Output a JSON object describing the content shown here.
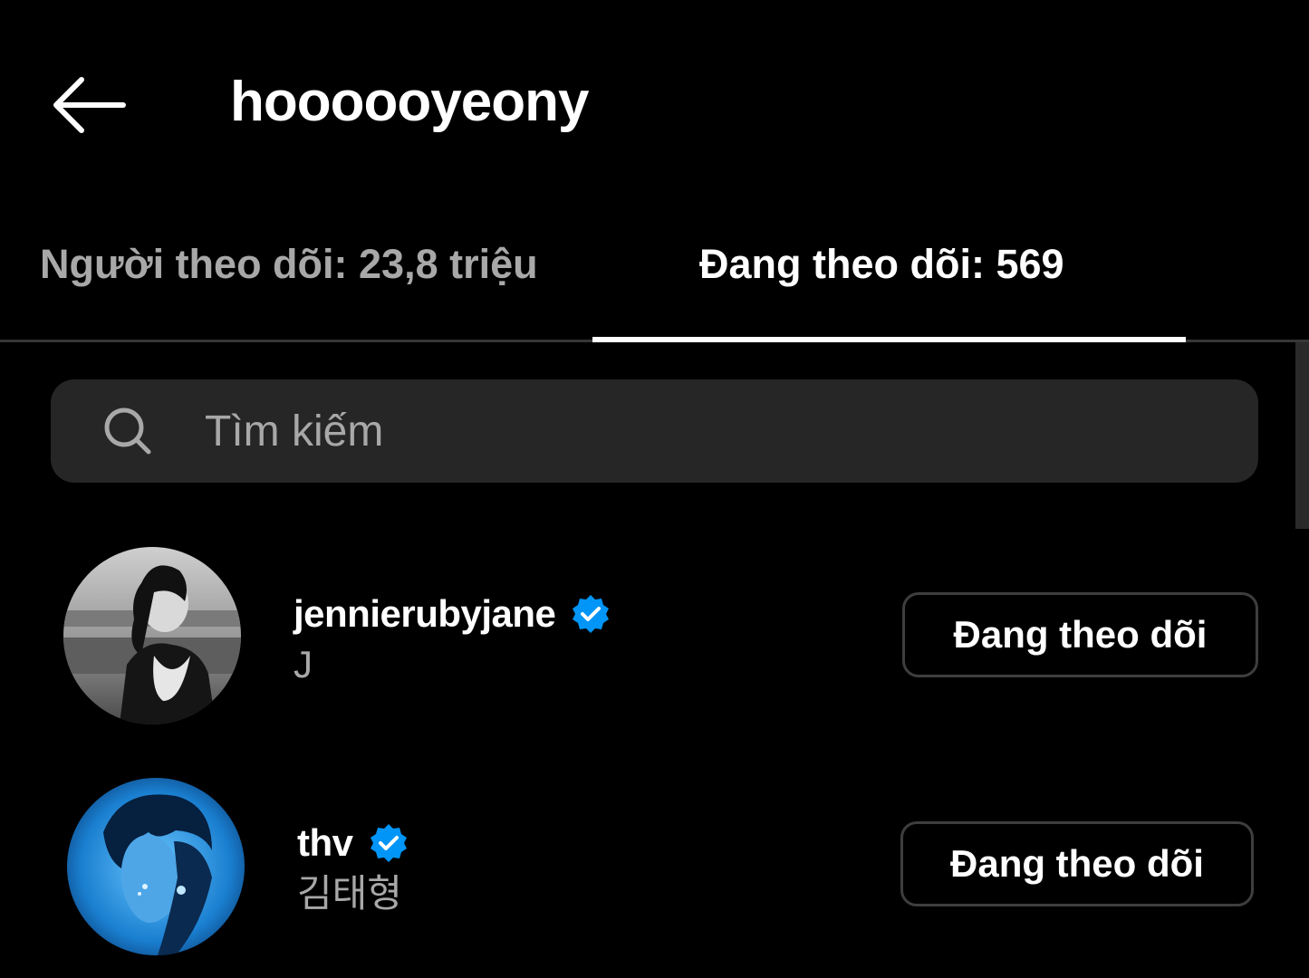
{
  "header": {
    "back_icon": "arrow-left-icon",
    "title": "hoooooyeony"
  },
  "tabs": [
    {
      "label": "Người theo dõi: 23,8 triệu",
      "active": false
    },
    {
      "label": "Đang theo dõi: 569",
      "active": true
    }
  ],
  "search": {
    "icon": "search-icon",
    "placeholder": "Tìm kiếm",
    "value": ""
  },
  "list": [
    {
      "username": "jennierubyjane",
      "verified": true,
      "full_name": "J",
      "button_label": "Đang theo dõi"
    },
    {
      "username": "thv",
      "verified": true,
      "full_name": "김태형",
      "button_label": "Đang theo dõi"
    }
  ],
  "colors": {
    "background": "#000000",
    "search_bg": "#262626",
    "secondary_text": "#a8a8a8",
    "verified_blue": "#0095f6",
    "button_border": "#3e3e3e",
    "divider": "#363636"
  }
}
